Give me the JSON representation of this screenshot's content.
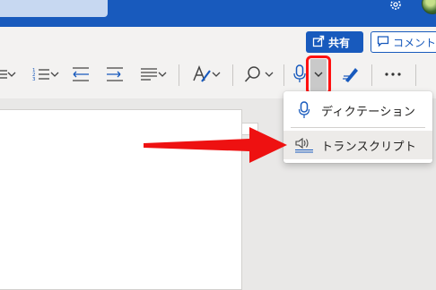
{
  "header": {
    "share_label": "共有",
    "comment_label": "コメント"
  },
  "icons": {
    "settings": "gear-icon",
    "share": "share-icon",
    "comment": "comment-icon",
    "bullets": "bulleted-list-icon",
    "numbering": "numbered-list-icon",
    "decrease_indent": "decrease-indent-icon",
    "increase_indent": "increase-indent-icon",
    "align": "align-text-icon",
    "styles": "styles-icon",
    "find": "search-icon",
    "dictate": "microphone-icon",
    "editor": "editor-pen-icon",
    "more": "more-options-icon"
  },
  "dictate_menu": {
    "items": [
      {
        "label": "ディクテーション",
        "icon": "microphone-icon"
      },
      {
        "label": "トランスクリプト",
        "icon": "transcribe-icon"
      }
    ]
  },
  "colors": {
    "brand": "#185abd",
    "highlight": "#ff1111",
    "arrow": "#ee1111"
  }
}
